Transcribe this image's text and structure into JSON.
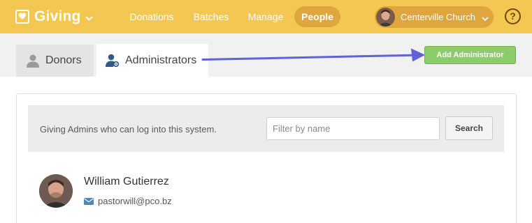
{
  "app": {
    "name": "Giving"
  },
  "nav": {
    "items": [
      {
        "label": "Donations",
        "active": false
      },
      {
        "label": "Batches",
        "active": false
      },
      {
        "label": "Manage",
        "active": false
      },
      {
        "label": "People",
        "active": true
      }
    ]
  },
  "org": {
    "name": "Centerville Church"
  },
  "help": {
    "label": "?"
  },
  "tabs": [
    {
      "label": "Donors",
      "icon": "person-icon",
      "active": false
    },
    {
      "label": "Administrators",
      "icon": "admin-person-icon",
      "active": true
    }
  ],
  "actions": {
    "add_admin_label": "Add Administrator"
  },
  "filter": {
    "description": "Giving Admins who can log into this system.",
    "placeholder": "Filter by name",
    "value": "",
    "search_label": "Search"
  },
  "admins": [
    {
      "name": "William Gutierrez",
      "email": "pastorwill@pco.bz"
    }
  ],
  "colors": {
    "header_bg": "#f3c752",
    "header_active": "#dea63c",
    "primary_button": "#8ccc6b",
    "annotation_arrow": "#5f62d8"
  }
}
